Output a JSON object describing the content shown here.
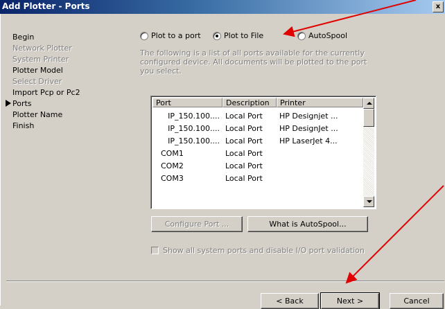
{
  "window": {
    "title": "Add Plotter - Ports",
    "close_label": "x"
  },
  "nav": {
    "items": [
      {
        "label": "Begin",
        "state": "normal"
      },
      {
        "label": "Network Plotter",
        "state": "disabled"
      },
      {
        "label": "System Printer",
        "state": "disabled"
      },
      {
        "label": "Plotter Model",
        "state": "normal"
      },
      {
        "label": "Select Driver",
        "state": "disabled"
      },
      {
        "label": "Import Pcp or Pc2",
        "state": "normal"
      },
      {
        "label": "Ports",
        "state": "current"
      },
      {
        "label": "Plotter Name",
        "state": "normal"
      },
      {
        "label": "Finish",
        "state": "normal"
      }
    ]
  },
  "output_options": {
    "plot_to_port": "Plot to a port",
    "plot_to_file": "Plot to File",
    "autospool": "AutoSpool",
    "selected": "plot_to_file"
  },
  "description": "The following is a list of all ports available for the currently configured device. All documents will be plotted to the port you select.",
  "ports_table": {
    "headers": {
      "port": "Port",
      "description": "Description",
      "printer": "Printer"
    },
    "rows": [
      {
        "port": "IP_150.100....",
        "description": "Local Port",
        "printer": "HP Designjet ..."
      },
      {
        "port": "IP_150.100....",
        "description": "Local Port",
        "printer": "HP DesignJet ..."
      },
      {
        "port": "IP_150.100....",
        "description": "Local Port",
        "printer": "HP LaserJet 4..."
      },
      {
        "port": "COM1",
        "description": "Local Port",
        "printer": ""
      },
      {
        "port": "COM2",
        "description": "Local Port",
        "printer": ""
      },
      {
        "port": "COM3",
        "description": "Local Port",
        "printer": ""
      }
    ]
  },
  "buttons": {
    "configure_port": "Configure Port ...",
    "what_is_autospool": "What is AutoSpool...",
    "back": "< Back",
    "next": "Next >",
    "cancel": "Cancel"
  },
  "checkbox": {
    "label": "Show all system ports and disable I/O port validation",
    "checked": false
  },
  "annotation_color": "#e00000"
}
